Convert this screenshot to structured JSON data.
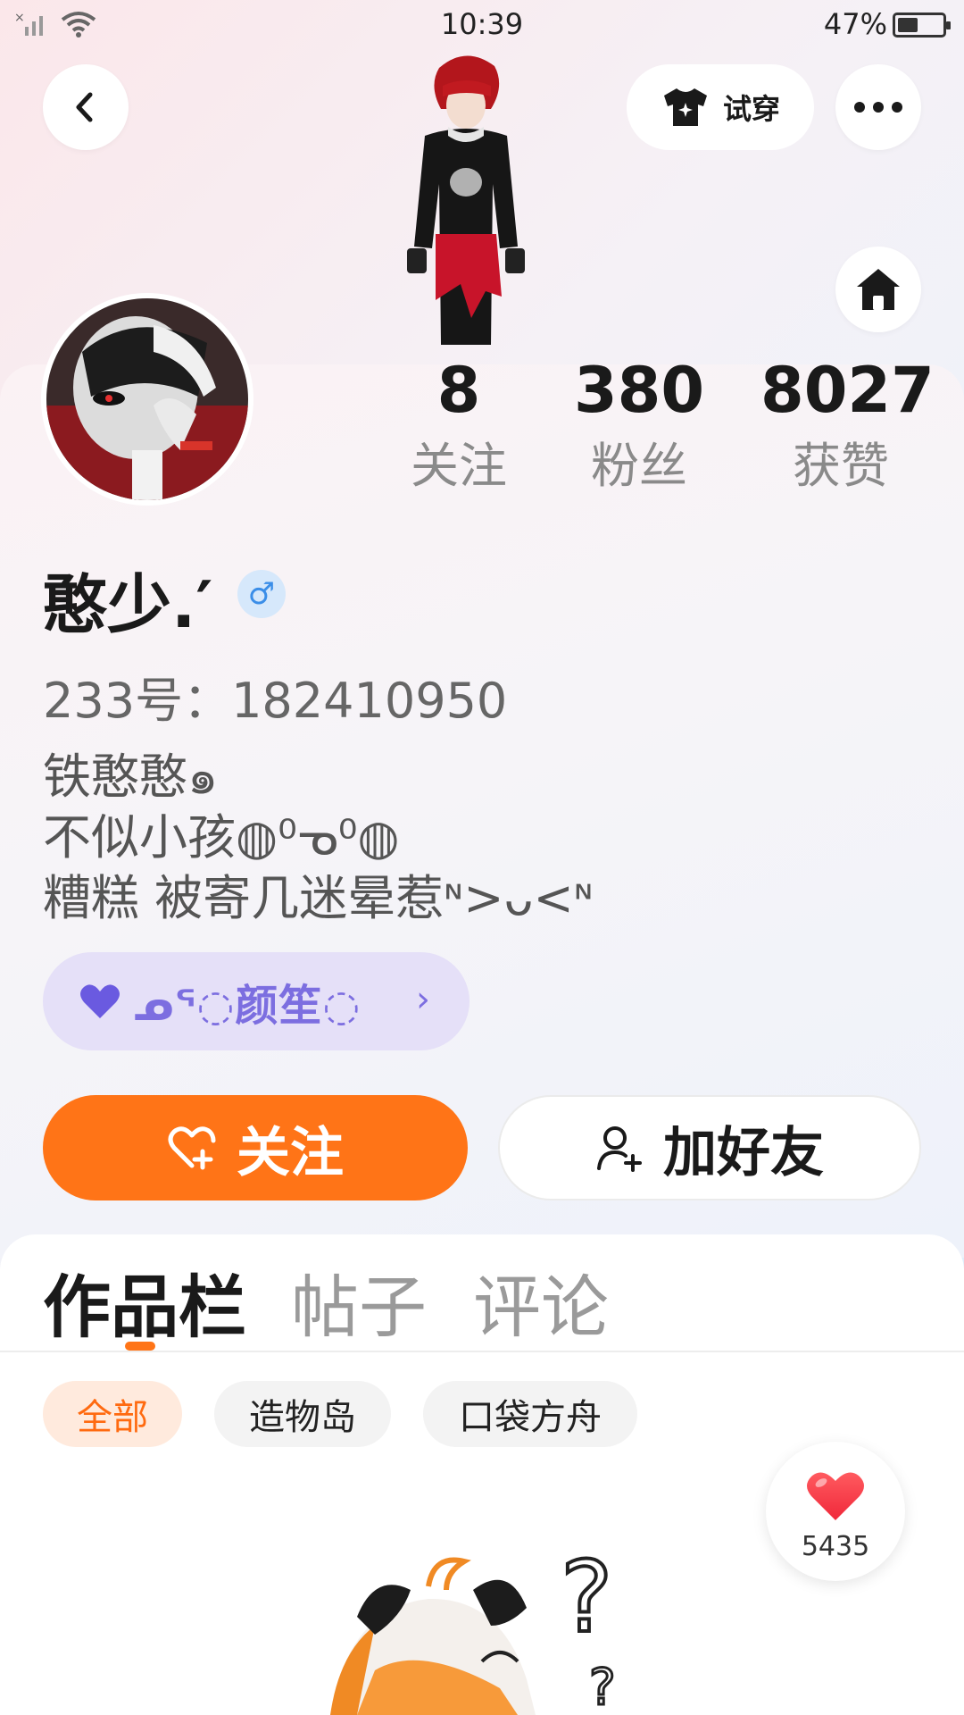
{
  "status_bar": {
    "time": "10:39",
    "battery": "47%"
  },
  "header": {
    "try_on_label": "试穿"
  },
  "stats": [
    {
      "value": "8",
      "label": "关注"
    },
    {
      "value": "380",
      "label": "粉丝"
    },
    {
      "value": "8027",
      "label": "获赞"
    }
  ],
  "profile": {
    "username": "憨少.′",
    "gender_symbol": "♂",
    "uid": "233号：182410950",
    "bio": [
      "铁憨憨๑",
      "不似小孩◍⁰ᓀ⁰◍",
      "糟糕 被寄几迷晕惹ᶰ>ᴗ<ᶰ"
    ],
    "badge": {
      "text": "ᓄᕐ◌颜笙◌",
      "chevron": "›"
    }
  },
  "actions": {
    "follow_label": "关注",
    "add_friend_label": "加好友"
  },
  "tabs": [
    {
      "label": "作品栏",
      "active": true
    },
    {
      "label": "帖子",
      "active": false
    },
    {
      "label": "评论",
      "active": false
    }
  ],
  "filters": [
    {
      "label": "全部",
      "active": true
    },
    {
      "label": "造物岛",
      "active": false
    },
    {
      "label": "口袋方舟",
      "active": false
    }
  ],
  "like_fab": {
    "count": "5435"
  },
  "colors": {
    "accent": "#ff7417",
    "badge_text": "#7c6ee0",
    "gender": "#3b8ee8"
  }
}
